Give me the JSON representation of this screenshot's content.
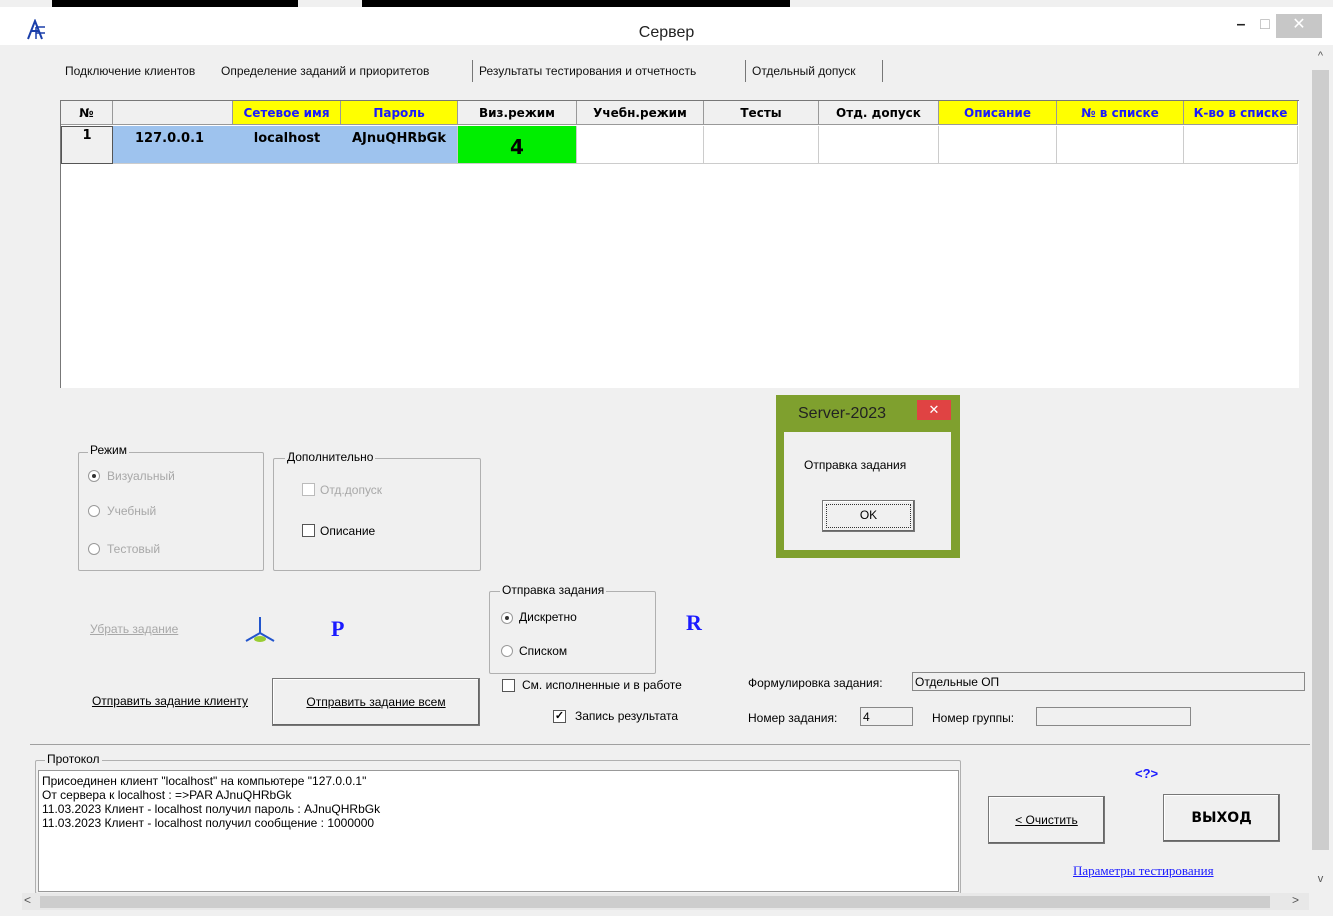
{
  "window": {
    "title": "Сервер",
    "minimize": "–",
    "maximize": "□",
    "close": "✕",
    "logo": "A-logo-icon"
  },
  "tabs": [
    {
      "label": "Подключение клиентов"
    },
    {
      "label": "Определение заданий и приоритетов"
    },
    {
      "label": "Результаты тестирования и отчетность"
    },
    {
      "label": "Отдельный допуск"
    }
  ],
  "grid": {
    "columns": [
      "№",
      "",
      "Сетевое имя",
      "Пароль",
      "Виз.режим",
      "Учебн.режим",
      "Тесты",
      "Отд. допуск",
      "Описание",
      "№ в списке",
      "К-во в списке"
    ],
    "rows": [
      {
        "num": "1",
        "ip": "127.0.0.1",
        "name": "localhost",
        "password": "AJnuQHRbGk",
        "vis": "4",
        "edu": "",
        "tests": "",
        "sep": "",
        "desc": "",
        "num_in_list": "",
        "count_in_list": ""
      }
    ],
    "colors": {
      "header_yellow": "#ffff00",
      "header_text_blue": "#1a1aff",
      "row_highlight": "#9ec3ee",
      "vis_cell": "#00ee00"
    }
  },
  "mode": {
    "legend": "Режим",
    "options": [
      {
        "label": "Визуальный",
        "selected": true
      },
      {
        "label": "Учебный",
        "selected": false
      },
      {
        "label": "Тестовый",
        "selected": false
      }
    ]
  },
  "extra": {
    "legend": "Дополнительно",
    "options": [
      {
        "label": "Отд.допуск",
        "checked": false
      },
      {
        "label": "Описание",
        "checked": false
      }
    ]
  },
  "send_task": {
    "legend": "Отправка задания",
    "options": [
      {
        "label": "Дискретно",
        "selected": true
      },
      {
        "label": "Списком",
        "selected": false
      }
    ]
  },
  "remove_task_link": "Убрать задание",
  "letter_p": "P",
  "letter_r": "R",
  "btn_send_client": "Отправить задание клиенту",
  "btn_send_all": "Отправить задание всем",
  "chk_show_done": "См. исполненные и в работе",
  "chk_write_result": "Запись результата",
  "task_wording_label": "Формулировка задания:",
  "task_wording_value": "Отдельные ОП",
  "task_number_label": "Номер задания:",
  "task_number_value": "4",
  "group_number_label": "Номер группы:",
  "group_number_value": "",
  "dialog": {
    "title": "Server-2023",
    "message": "Отправка задания",
    "ok": "OK",
    "close": "✕"
  },
  "protocol": {
    "legend": "Протокол",
    "lines": [
      "Присоединен клиент \"localhost\" на компьютере \"127.0.0.1\"",
      " От сервера к localhost : =>PAR AJnuQHRbGk",
      "11.03.2023 Клиент - localhost получил пароль : AJnuQHRbGk",
      "11.03.2023 Клиент - localhost получил сообщение : 1000000"
    ]
  },
  "help_link": "<?>",
  "btn_clear": "< Очистить",
  "btn_exit": "ВЫХОД",
  "test_params_link": "Параметры тестирования"
}
